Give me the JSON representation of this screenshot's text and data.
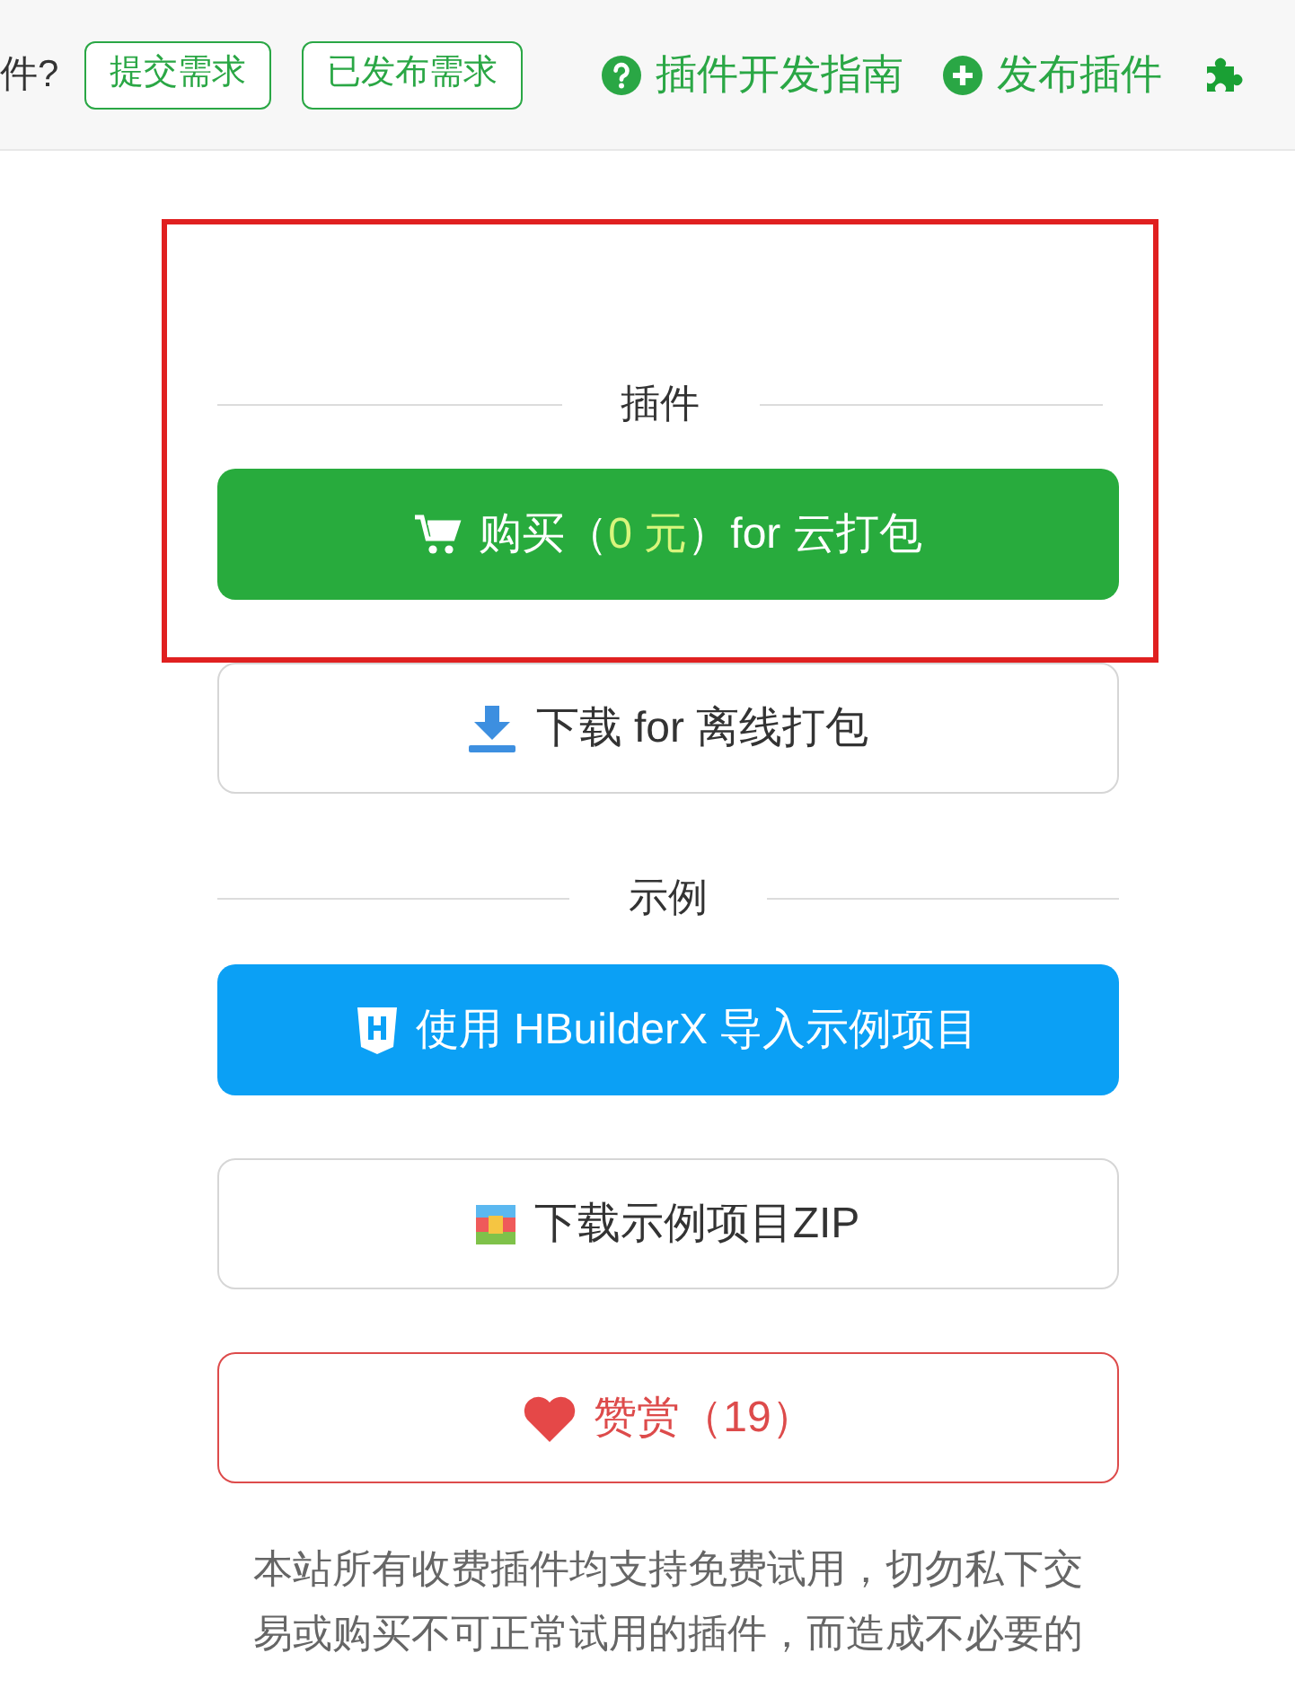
{
  "top_bar": {
    "prompt": "件?",
    "buttons": [
      "提交需求",
      "已发布需求"
    ],
    "links": [
      {
        "kind": "help",
        "label": "插件开发指南"
      },
      {
        "kind": "add",
        "label": "发布插件"
      },
      {
        "kind": "puzzle"
      }
    ]
  },
  "plugin_section": {
    "highlighted": true,
    "divider": "插件",
    "buy_button": {
      "parts": [
        {
          "text": "购买（",
          "highlight": false
        },
        {
          "text": "0 元",
          "highlight": true
        },
        {
          "text": "）for 云打包",
          "highlight": false
        }
      ]
    }
  },
  "download_button": "下载 for 离线打包",
  "example_section": {
    "divider": "示例",
    "import_button": "使用 HBuilderX 导入示例项目",
    "zip_button": "下载示例项目ZIP"
  },
  "reward_button": "赞赏（19）",
  "notice": "本站所有收费插件均支持免费试用，切勿私下交易或购买不可正常试用的插件，而造成不必要的"
}
